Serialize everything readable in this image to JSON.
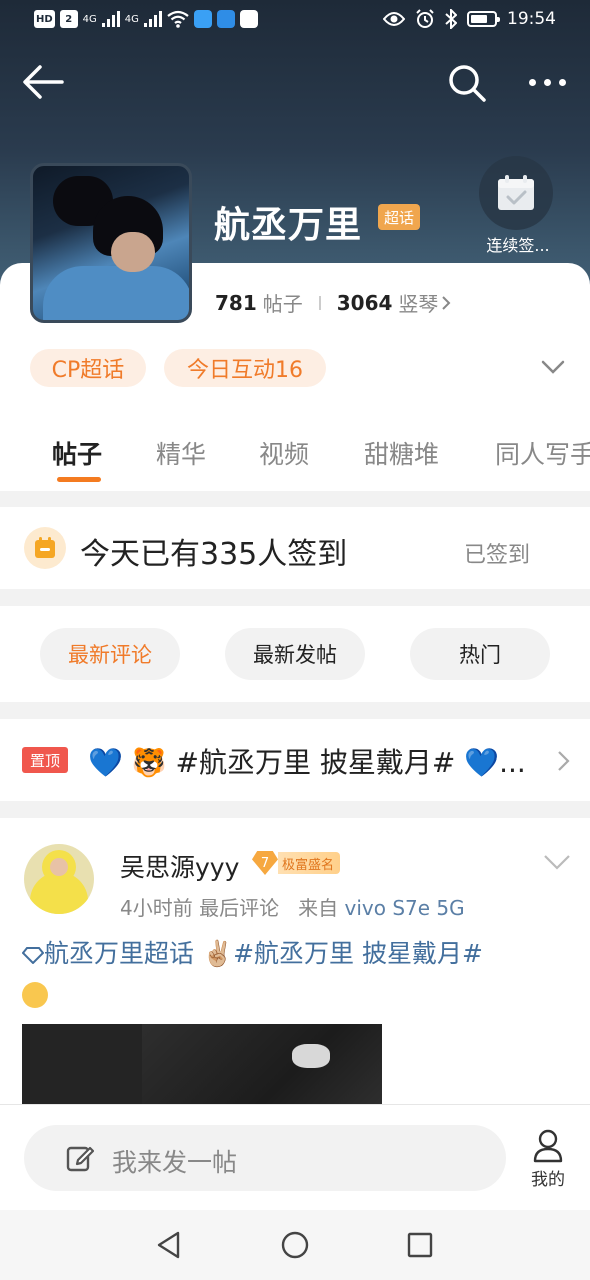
{
  "status_bar": {
    "left_chips": [
      "HD",
      "2"
    ],
    "network_1": "4G",
    "network_2": "4G",
    "time": "19:54"
  },
  "topic": {
    "title": "航丞万里",
    "badge": "超话",
    "checkin_action": "连续签..."
  },
  "stats": {
    "posts_count": "781",
    "posts_label": "帖子",
    "fans_count": "3064",
    "fans_label": "竖琴"
  },
  "chips": {
    "cp": "CP超话",
    "interaction": "今日互动16"
  },
  "tabs": [
    "帖子",
    "精华",
    "视频",
    "甜糖堆",
    "同人写手"
  ],
  "checkin": {
    "text": "今天已有335人签到",
    "status": "已签到"
  },
  "sort": {
    "latest_comment": "最新评论",
    "latest_post": "最新发帖",
    "hot": "热门"
  },
  "pinned": {
    "tag": "置顶",
    "text": "💙 🐯 #航丞万里 披星戴月# 💙..."
  },
  "post": {
    "author": "吴思源yyy",
    "level": "7",
    "level_title": "极富盛名",
    "time": "4小时前",
    "comment_note": "最后评论",
    "source_prefix": "来自",
    "source": "vivo S7e 5G",
    "body": "航丞万里超话 ✌🏼#航丞万里 披星戴月#"
  },
  "bottom": {
    "compose_placeholder": "我来发一帖",
    "mine_label": "我的"
  },
  "colors": {
    "accent": "#f07b2a",
    "link": "#436f9d",
    "pin_red": "#f0574d"
  }
}
